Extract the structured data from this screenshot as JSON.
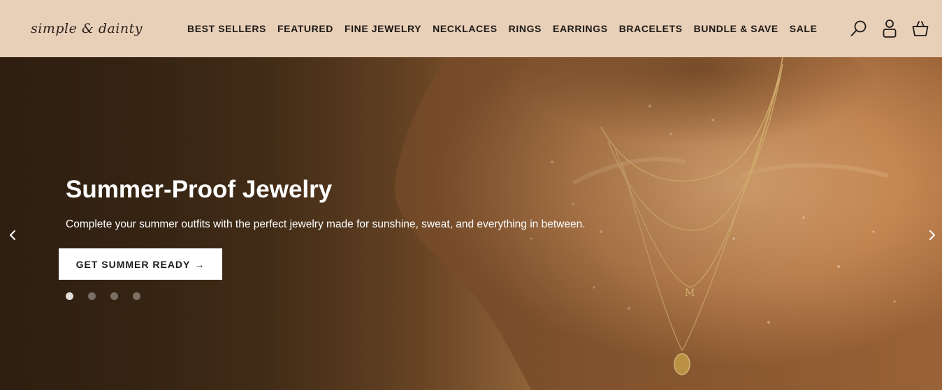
{
  "brand": {
    "logo_text": "simple & dainty"
  },
  "nav": {
    "items": [
      {
        "label": "BEST SELLERS"
      },
      {
        "label": "FEATURED"
      },
      {
        "label": "FINE JEWELRY"
      },
      {
        "label": "NECKLACES"
      },
      {
        "label": "RINGS"
      },
      {
        "label": "EARRINGS"
      },
      {
        "label": "BRACELETS"
      },
      {
        "label": "BUNDLE & SAVE"
      },
      {
        "label": "SALE"
      }
    ]
  },
  "header_icons": [
    "search-icon",
    "account-icon",
    "cart-icon"
  ],
  "hero": {
    "title": "Summer-Proof Jewelry",
    "subtitle": "Complete your summer outfits with the perfect jewelry made for sunshine, sweat, and everything in between.",
    "cta_label": "GET SUMMER READY",
    "cta_arrow": "→",
    "slides_total": 4,
    "active_slide": 1
  },
  "colors": {
    "header_bg": "#e8cfb8",
    "text_dark": "#1e1a16",
    "hero_text": "#ffffff",
    "cta_bg": "#ffffff"
  }
}
